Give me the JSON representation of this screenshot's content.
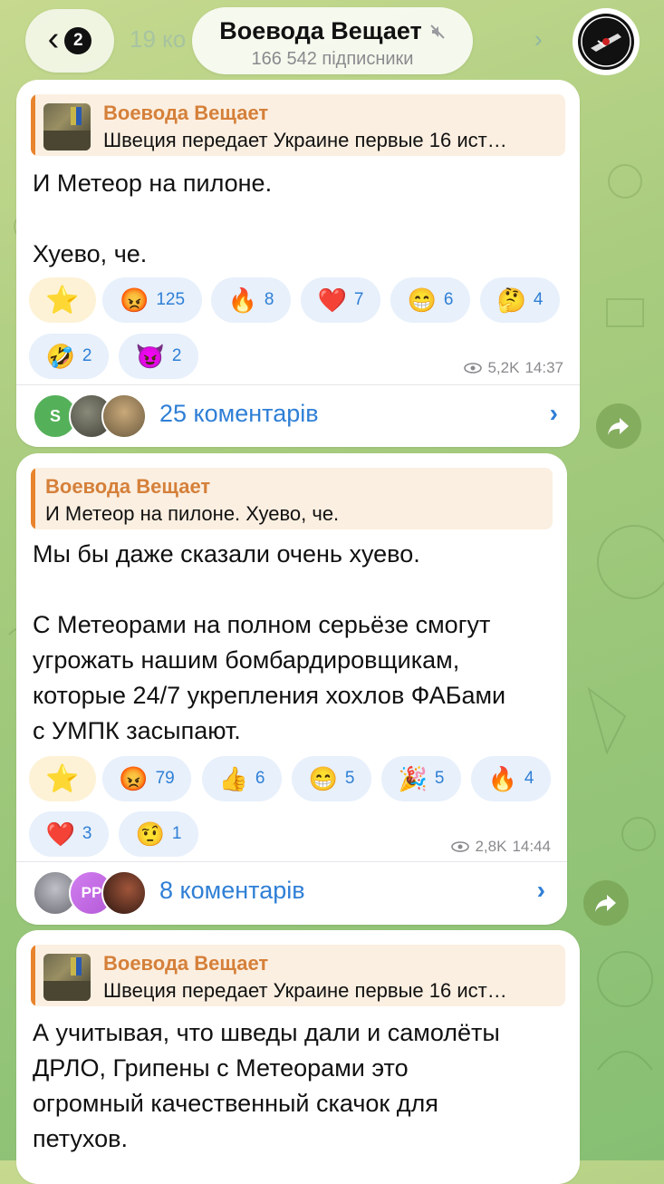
{
  "header": {
    "back_badge": "2",
    "ghost_text": "19 ко",
    "channel_title": "Воевода Вещает",
    "subscribers": "166 542 підписники"
  },
  "posts": [
    {
      "quote_author": "Воевода Вещает",
      "quote_text": "Швеция передает Украине первые 16 ист…",
      "message": "И Метеор на пилоне.\n\nХуево, че.",
      "reactions": [
        {
          "emoji": "😡",
          "count": "125"
        },
        {
          "emoji": "🔥",
          "count": "8"
        },
        {
          "emoji": "❤️",
          "count": "7"
        },
        {
          "emoji": "😁",
          "count": "6"
        },
        {
          "emoji": "🤔",
          "count": "4"
        },
        {
          "emoji": "🤣",
          "count": "2"
        },
        {
          "emoji": "😈",
          "count": "2"
        }
      ],
      "views": "5,2K",
      "time": "14:37",
      "comments": "25 коментарів",
      "commenter_initial": "S"
    },
    {
      "quote_author": "Воевода Вещает",
      "quote_text": "И Метеор на пилоне. Хуево, че.",
      "message": "Мы бы даже сказали очень хуево.\n\nС Метеорами на полном серьёзе смогут\nугрожать нашим бомбардировщикам,\nкоторые 24/7 укрепления хохлов ФАБами\nс УМПК засыпают.",
      "reactions": [
        {
          "emoji": "😡",
          "count": "79"
        },
        {
          "emoji": "👍",
          "count": "6"
        },
        {
          "emoji": "😁",
          "count": "5"
        },
        {
          "emoji": "🎉",
          "count": "5"
        },
        {
          "emoji": "🔥",
          "count": "4"
        },
        {
          "emoji": "❤️",
          "count": "3"
        },
        {
          "emoji": "🤨",
          "count": "1"
        }
      ],
      "views": "2,8K",
      "time": "14:44",
      "comments": "8 коментарів",
      "commenter_initial": "PP"
    },
    {
      "quote_author": "Воевода Вещает",
      "quote_text": "Швеция передает Украине первые 16 ист…",
      "message": "А учитывая, что шведы дали и самолёты\nДРЛО, Грипены с Метеорами это\nогромный качественный скачок для\nпетухов."
    }
  ],
  "colors": {
    "accent": "#2f7fd6",
    "quote_author": "#d5803a",
    "quote_bar": "#e8842d"
  }
}
